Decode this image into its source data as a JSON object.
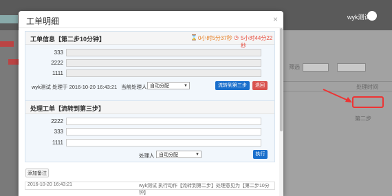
{
  "background": {
    "user_name": "wyk测试",
    "column_header": "处理时间",
    "filter_label": "筛选",
    "row_text": "第二步"
  },
  "modal": {
    "title": "工单明细",
    "close_icon": "×",
    "info_panel": {
      "title": "工单信息【第二步10分钟】",
      "timer_step": "0小时5分37秒",
      "timer_total": "5小时44分22秒",
      "fields": [
        {
          "label": "333",
          "value": ""
        },
        {
          "label": "2222",
          "value": ""
        },
        {
          "label": "1111",
          "value": ""
        }
      ],
      "meta": "wyk测试 处理于 2016-10-20 16:43:21",
      "handler_label": "当前处理人",
      "handler_select": "自动分配",
      "forward_button": "流转到第三步",
      "return_button": "退回"
    },
    "process_panel": {
      "title": "处理工单【流转到第三步】",
      "fields": [
        {
          "label": "2222",
          "value": ""
        },
        {
          "label": "333",
          "value": ""
        },
        {
          "label": "1111",
          "value": ""
        }
      ],
      "handler_label": "处理人",
      "handler_select": "自动分配",
      "execute_button": "执行"
    },
    "add_note_button": "添加备注",
    "log": {
      "time": "2016-10-20 16:43:21",
      "text": "wyk测试 执行动作【流转到第二步】处理意见为【第二步10分钟】"
    }
  },
  "colors": {
    "primary": "#1a6fcc",
    "danger": "#d9534f",
    "timer": "#e67e22",
    "highlight": "#e33333"
  }
}
